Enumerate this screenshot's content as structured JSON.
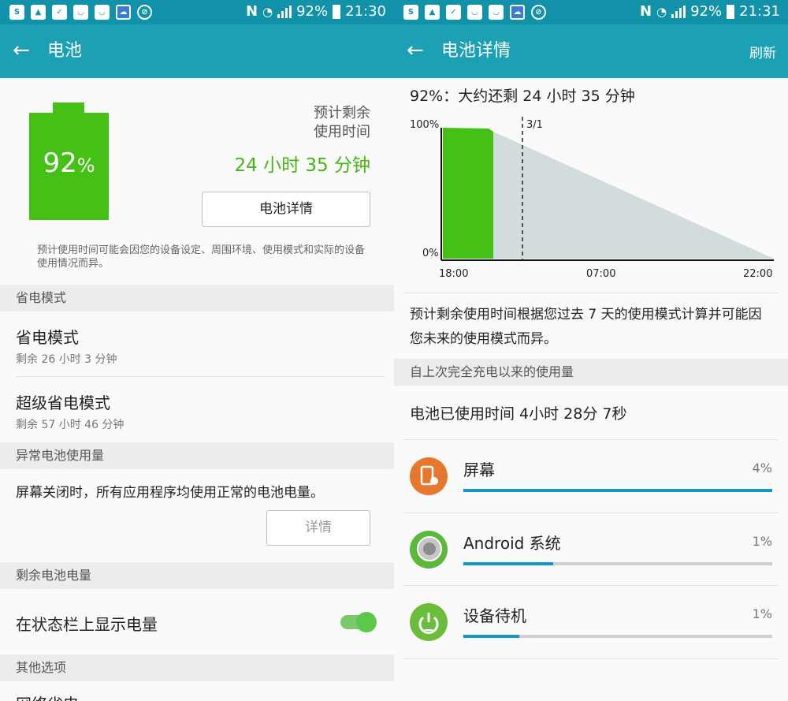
{
  "status_left": {
    "battery": "92%",
    "time": "21:30"
  },
  "status_right": {
    "battery": "92%",
    "time": "21:31"
  },
  "battery_screen": {
    "title": "电池",
    "battery_level": "92",
    "battery_unit": "%",
    "est_label_line1": "预计剩余",
    "est_label_line2": "使用时间",
    "est_time": "24 小时 35 分钟",
    "details_button": "电池详情",
    "note": "预计使用时间可能会因您的设备设定、周围环境、使用模式和实际的设备使用情况而异。",
    "section_power_saving": "省电模式",
    "power_saving_title": "省电模式",
    "power_saving_sub": "剩余 26 小时 3 分钟",
    "ultra_saving_title": "超级省电模式",
    "ultra_saving_sub": "剩余 57 小时 46 分钟",
    "section_abnormal": "异常电池使用量",
    "abnormal_body": "屏幕关闭时，所有应用程序均使用正常的电池电量。",
    "more_button": "详情",
    "section_remaining": "剩余电池电量",
    "show_in_statusbar": "在状态栏上显示电量",
    "show_in_statusbar_on": true,
    "section_other": "其他选项",
    "partial_item": "网络省电"
  },
  "detail_screen": {
    "title": "电池详情",
    "refresh": "刷新",
    "pct_line": "92%：大约还剩 24 小时 35 分钟",
    "explanation": "预计剩余使用时间根据您过去 7 天的使用模式计算并可能因您未来的使用模式而异。",
    "section_usage": "自上次完全充电以来的使用量",
    "used_time": "电池已使用时间 4小时 28分 7秒",
    "apps": [
      {
        "name": "屏幕",
        "percent": "4%",
        "share": 1.0,
        "color": "#e8772e"
      },
      {
        "name": "Android 系统",
        "percent": "1%",
        "share": 0.29,
        "color": "#5cb83a"
      },
      {
        "name": "设备待机",
        "percent": "1%",
        "share": 0.18,
        "color": "#6bbd3c"
      }
    ]
  },
  "chart_data": {
    "type": "area",
    "y_axis_labels": [
      "100%",
      "0%"
    ],
    "x_tick_labels": [
      "18:00",
      "07:00",
      "22:00"
    ],
    "marker_label": "3/1",
    "ylim": [
      0,
      100
    ],
    "actual": {
      "x": [
        "18:00",
        "19:40"
      ],
      "y": [
        100,
        97
      ]
    },
    "predicted": {
      "x": [
        "19:40",
        "22:00 (+1 day)"
      ],
      "y": [
        97,
        0
      ]
    },
    "colors": {
      "actual": "#45c116",
      "predicted": "#d3dcdd"
    }
  }
}
